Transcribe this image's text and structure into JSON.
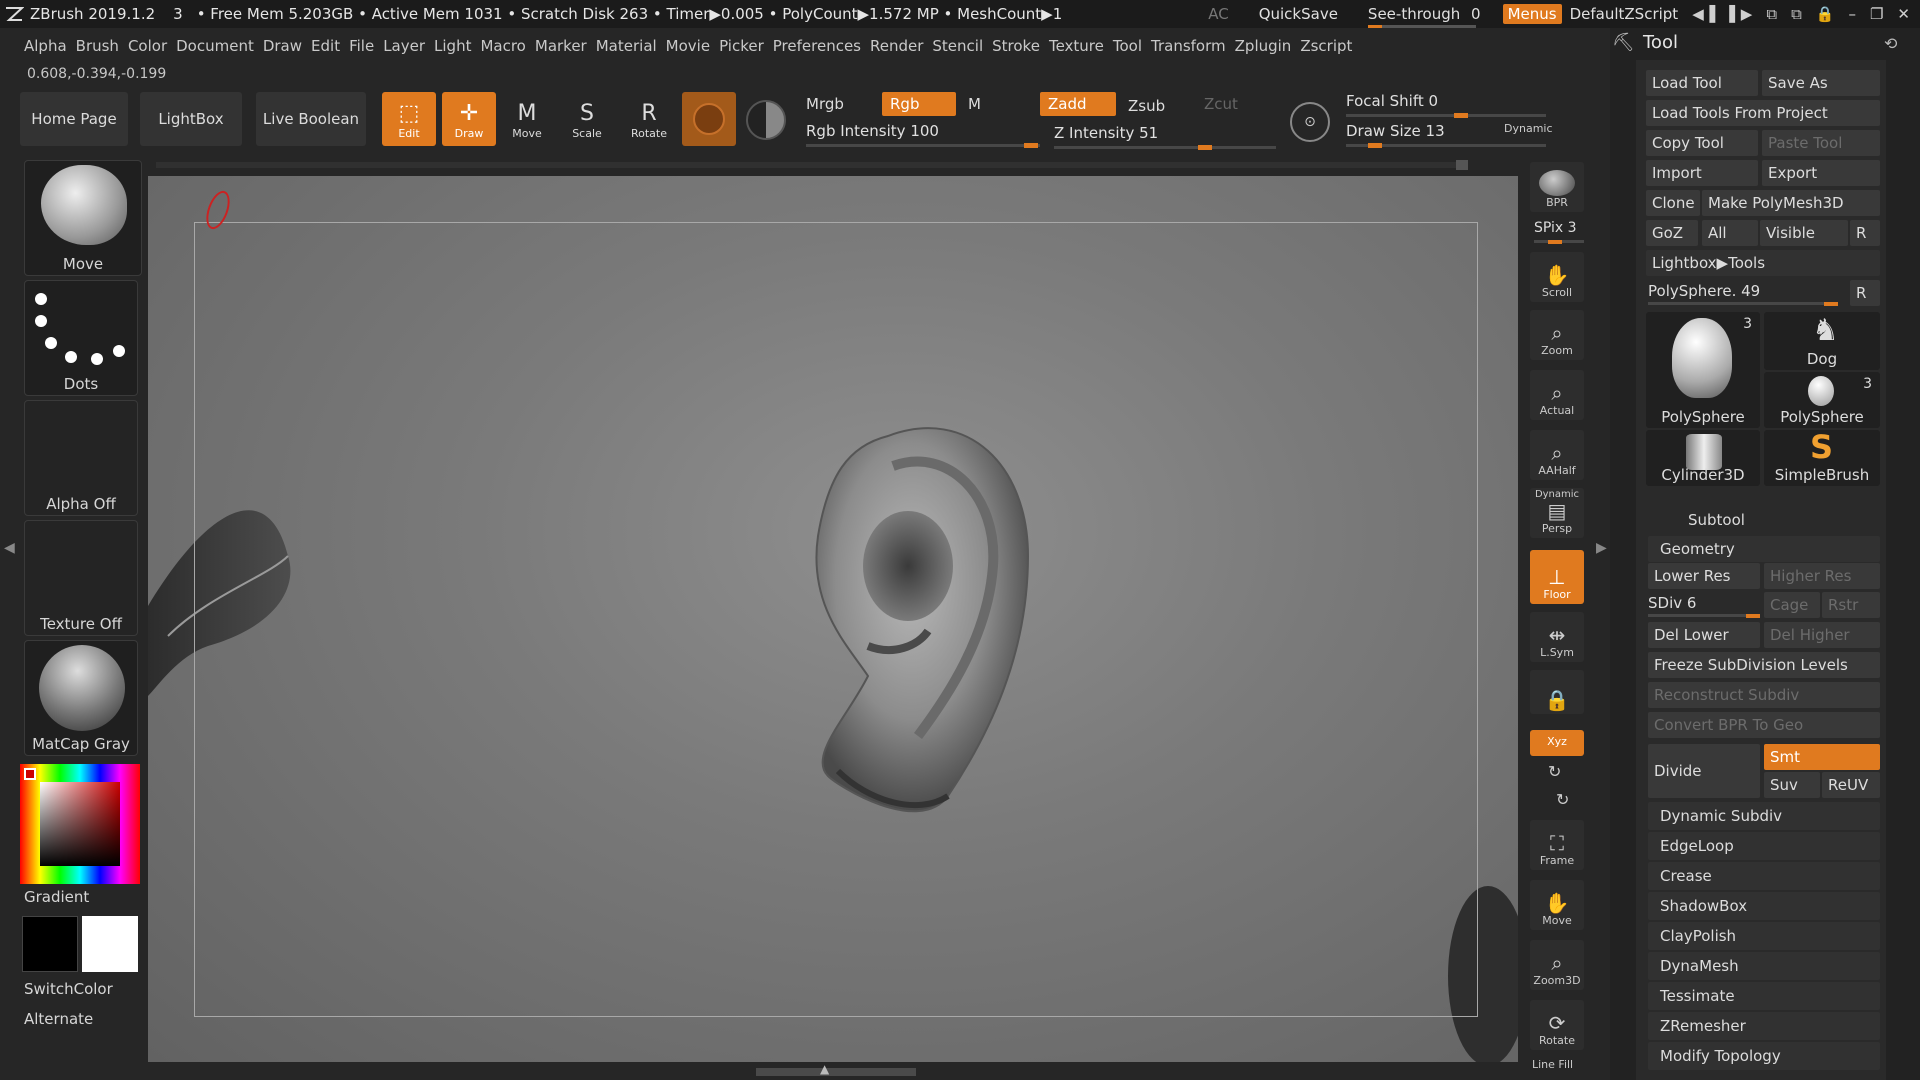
{
  "titlebar": {
    "app_title": "ZBrush 2019.1.2",
    "doc_num": "3",
    "stats": "• Free Mem 5.203GB • Active Mem 1031 • Scratch Disk 263 • Timer▶0.005 • PolyCount▶1.572 MP • MeshCount▶1",
    "ac": "AC",
    "quicksave": "QuickSave",
    "see_through_label": "See-through",
    "see_through_value": "0",
    "menus": "Menus",
    "script": "DefaultZScript"
  },
  "menubar": [
    "Alpha",
    "Brush",
    "Color",
    "Document",
    "Draw",
    "Edit",
    "File",
    "Layer",
    "Light",
    "Macro",
    "Marker",
    "Material",
    "Movie",
    "Picker",
    "Preferences",
    "Render",
    "Stencil",
    "Stroke",
    "Texture",
    "Tool",
    "Transform",
    "Zplugin",
    "Zscript"
  ],
  "coords": "0.608,-0.394,-0.199",
  "top_buttons": {
    "home": "Home Page",
    "lightbox": "LightBox",
    "live_boolean": "Live Boolean"
  },
  "tools": {
    "edit": "Edit",
    "draw": "Draw",
    "move": "Move",
    "scale": "Scale",
    "rotate": "Rotate"
  },
  "options": {
    "mrgb": "Mrgb",
    "rgb": "Rgb",
    "m": "M",
    "zadd": "Zadd",
    "zsub": "Zsub",
    "zcut": "Zcut",
    "rgb_intensity_label": "Rgb Intensity",
    "rgb_intensity": "100",
    "z_intensity_label": "Z Intensity",
    "z_intensity": "51",
    "focal_shift_label": "Focal Shift",
    "focal_shift": "0",
    "draw_size_label": "Draw Size",
    "draw_size": "13",
    "dynamic": "Dynamic"
  },
  "left_shelf": {
    "brush": "Move",
    "stroke": "Dots",
    "alpha": "Alpha Off",
    "texture": "Texture Off",
    "material": "MatCap Gray",
    "gradient": "Gradient",
    "switch_color": "SwitchColor",
    "alternate": "Alternate"
  },
  "right_shelf": {
    "bpr": "BPR",
    "spix_label": "SPix",
    "spix": "3",
    "scroll": "Scroll",
    "zoom": "Zoom",
    "actual": "Actual",
    "aahalf": "AAHalf",
    "dynamic": "Dynamic",
    "persp": "Persp",
    "floor": "Floor",
    "lsym": "L.Sym",
    "xyz": "Xyz",
    "frame": "Frame",
    "move": "Move",
    "zoom3d": "Zoom3D",
    "rotate": "Rotate",
    "linefill": "Line Fill"
  },
  "palette": {
    "title": "Tool",
    "load_tool": "Load Tool",
    "save_as": "Save As",
    "load_from_project": "Load Tools From Project",
    "copy_tool": "Copy Tool",
    "paste_tool": "Paste Tool",
    "import": "Import",
    "export": "Export",
    "clone": "Clone",
    "make_polymesh": "Make PolyMesh3D",
    "goz": "GoZ",
    "all": "All",
    "visible": "Visible",
    "r": "R",
    "lightbox_tools": "Lightbox▶Tools",
    "current_tool": "PolySphere.",
    "current_tool_value": "49",
    "thumbs": [
      {
        "label": "PolySphere",
        "num": "3"
      },
      {
        "label": "Dog",
        "num": ""
      },
      {
        "label": "PolySphere",
        "num": "3"
      },
      {
        "label": "Cylinder3D",
        "num": ""
      },
      {
        "label": "SimpleBrush",
        "num": ""
      }
    ],
    "subtool": "Subtool",
    "geometry": "Geometry",
    "lower_res": "Lower Res",
    "higher_res": "Higher Res",
    "sdiv_label": "SDiv",
    "sdiv": "6",
    "cage": "Cage",
    "rstr": "Rstr",
    "del_lower": "Del Lower",
    "del_higher": "Del Higher",
    "freeze": "Freeze SubDivision Levels",
    "reconstruct": "Reconstruct Subdiv",
    "convert_bpr": "Convert BPR To Geo",
    "divide": "Divide",
    "smt": "Smt",
    "suv": "Suv",
    "reuv": "ReUV",
    "sections": [
      "Dynamic Subdiv",
      "EdgeLoop",
      "Crease",
      "ShadowBox",
      "ClayPolish",
      "DynaMesh",
      "Tessimate",
      "ZRemesher",
      "Modify Topology"
    ]
  },
  "colors": {
    "accent": "#e07a1f"
  }
}
